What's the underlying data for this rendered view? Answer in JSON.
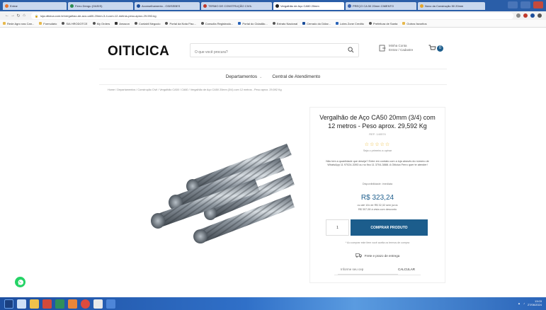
{
  "browser": {
    "tabs": [
      {
        "label": "Entrar",
        "active": false
      },
      {
        "label": "Ferro Dengu (OASIS)",
        "active": false
      },
      {
        "label": "Aconselhamento - OI5/SEBES",
        "active": false
      },
      {
        "label": "TERMO DE CONSTRUÇÃO CIVIL",
        "active": false
      },
      {
        "label": "Vergalhão de Aço CA50 20mm",
        "active": true
      },
      {
        "label": "PREÇO CA 50 20mm CIMENTO",
        "active": false
      },
      {
        "label": "Novo da Construção 50 20mm",
        "active": false
      }
    ],
    "url": "loja.oiticica.com.br/vergalhao-de-aco-ca50-20mm-3-4-com-12-metros-peso-aprox-29-592-kg",
    "bookmarks": [
      "Rede Agro nas Can...",
      "Formulário",
      "SIA HRODOTCE",
      "My Orders",
      "Amazon",
      "Contabil Negocio",
      "Portal da Nota Fisc...",
      "Consulta Registrado...",
      "Portal do Cidadão...",
      "Extrato Nacional",
      "Cerrado do Dólar...",
      "Lotes Zone Credito",
      "Prefeitura de Santa",
      "Outros favoritos"
    ]
  },
  "header": {
    "logo": "OITICICA",
    "search_placeholder": "O que você procura?",
    "account_line1": "Minha Conta",
    "account_line2": "Entrar / Cadastre",
    "cart_count": "0"
  },
  "menu": {
    "departments": "Departamentos",
    "support": "Central de Atendimento"
  },
  "breadcrumb": "Home  /  Departamentos  /  Construção Civil  /  Vergalhão CA50 / CA60  /  Vergalhão de Aço CA50 20mm (3/4) com 12 metros - Peso aprox. 29,592 Kg",
  "product": {
    "title": "Vergalhão de Aço CA50 20mm (3/4) com 12 metros - Peso aprox. 29,592 Kg",
    "sku": "REF: 140574",
    "stars": "☆☆☆☆☆",
    "rate_first": "Seja o primeiro a opinar",
    "help": "Não tem a quantidade que deseja? Entre em contato com a loja através do número de WhatsApp 11 97024-3393 ou no fixo 11 3704-3888. A Oiticica Ferro quer te atender!",
    "availability": "Disponibilidade: imediata",
    "price": "R$ 323,24",
    "installments_line1": "ou até 10x de R$ 32,32 sem juros",
    "installments_line2": "R$ 307,08 à vista com desconto",
    "quantity": "1",
    "buy_label": "COMPRAR PRODUTO",
    "note": "* Ao comprar este item você aceita os termos de compra",
    "shipping_label": "Frete e prazo de entrega",
    "cep_placeholder": "Informe seu cep",
    "cep_button": "CALCULAR"
  },
  "taskbar": {
    "time": "13:03",
    "date": "27/06/2024"
  },
  "colors": {
    "accent": "#1c5d8c",
    "star": "#e9b21c",
    "whatsapp": "#25d366"
  }
}
